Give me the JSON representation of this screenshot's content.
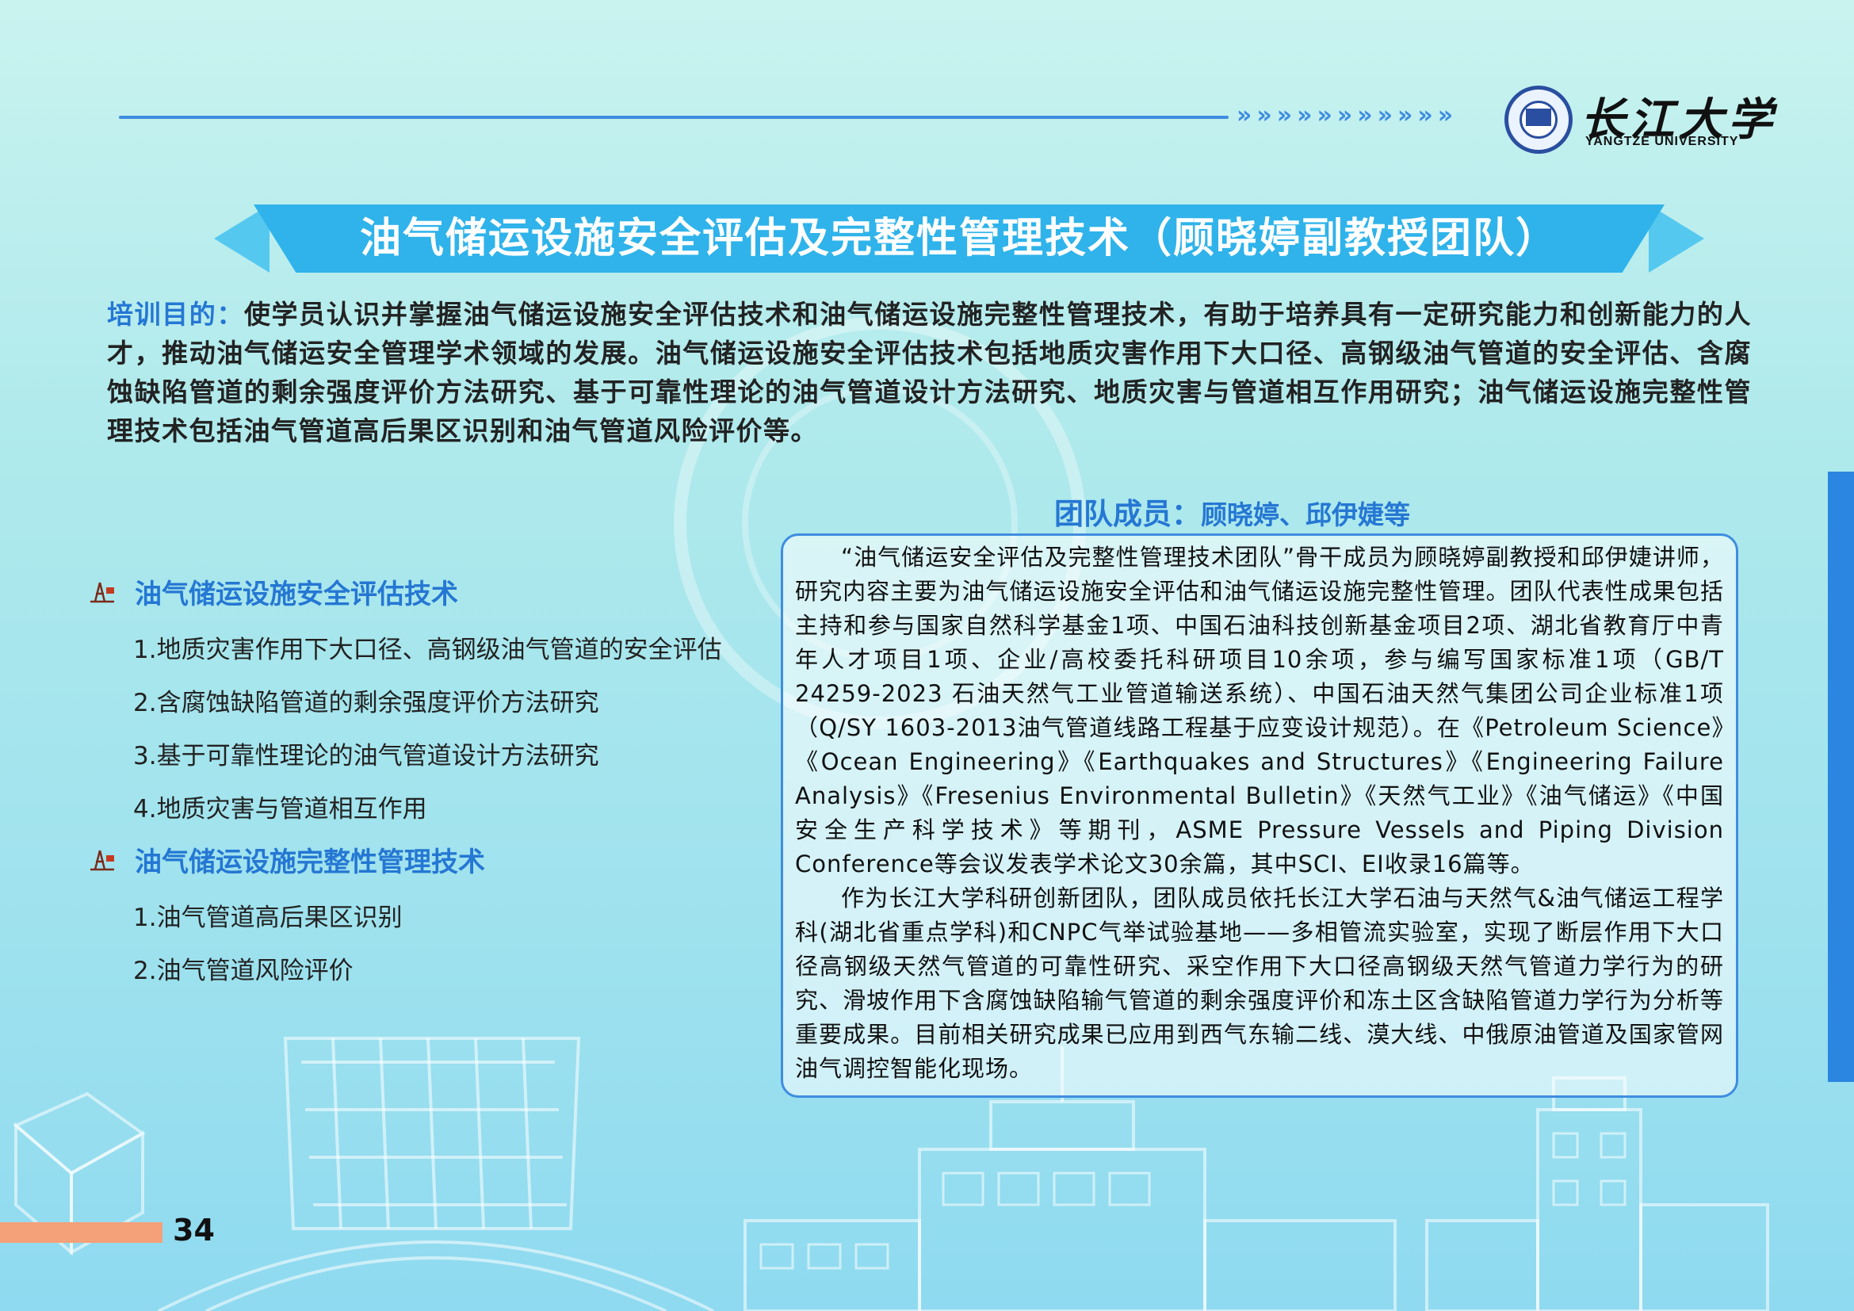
{
  "header": {
    "logo_cn": "长江大学",
    "logo_en": "YANGTZE UNIVERSITY",
    "chevrons": "»»»»»»»»»»»"
  },
  "title": "油气储运设施安全评估及完整性管理技术（顾晓婷副教授团队）",
  "purpose": {
    "label": "培训目的：",
    "text": "使学员认识并掌握油气储运设施安全评估技术和油气储运设施完整性管理技术，有助于培养具有一定研究能力和创新能力的人才，推动油气储运安全管理学术领域的发展。油气储运设施安全评估技术包括地质灾害作用下大口径、高钢级油气管道的安全评估、含腐蚀缺陷管道的剩余强度评价方法研究、基于可靠性理论的油气管道设计方法研究、地质灾害与管道相互作用研究；油气储运设施完整性管理技术包括油气管道高后果区识别和油气管道风险评价等。"
  },
  "sections": [
    {
      "heading": "油气储运设施安全评估技术",
      "items": [
        "1.地质灾害作用下大口径、高钢级油气管道的安全评估",
        "2.含腐蚀缺陷管道的剩余强度评价方法研究",
        "3.基于可靠性理论的油气管道设计方法研究",
        "4.地质灾害与管道相互作用"
      ]
    },
    {
      "heading": "油气储运设施完整性管理技术",
      "items": [
        "1.油气管道高后果区识别",
        "2.油气管道风险评价"
      ]
    }
  ],
  "team": {
    "label": "团队成员：",
    "members": "顾晓婷、邱伊婕等",
    "paragraphs": [
      "“油气储运安全评估及完整性管理技术团队”骨干成员为顾晓婷副教授和邱伊婕讲师，研究内容主要为油气储运设施安全评估和油气储运设施完整性管理。团队代表性成果包括主持和参与国家自然科学基金1项、中国石油科技创新基金项目2项、湖北省教育厅中青年人才项目1项、企业/高校委托科研项目10余项，参与编写国家标准1项（GB/T 24259-2023 石油天然气工业管道输送系统）、中国石油天然气集团公司企业标准1项（Q/SY 1603-2013油气管道线路工程基于应变设计规范）。在《Petroleum Science》《Ocean Engineering》《Earthquakes and Structures》《Engineering Failure Analysis》《Fresenius Environmental Bulletin》《天然气工业》《油气储运》《中国安全生产科学技术》等期刊，ASME Pressure Vessels and Piping Division Conference等会议发表学术论文30余篇，其中SCI、EI收录16篇等。",
      "作为长江大学科研创新团队，团队成员依托长江大学石油与天然气&油气储运工程学科(湖北省重点学科)和CNPC气举试验基地——多相管流实验室，实现了断层作用下大口径高钢级天然气管道的可靠性研究、采空作用下大口径高钢级天然气管道力学行为的研究、滑坡作用下含腐蚀缺陷输气管道的剩余强度评价和冻土区含缺陷管道力学行为分析等重要成果。目前相关研究成果已应用到西气东输二线、漠大线、中俄原油管道及国家管网油气调控智能化现场。"
    ]
  },
  "page_number": "34",
  "icons": {
    "section_icon": "oil-rig-icon",
    "logo": "university-seal-icon"
  },
  "colors": {
    "accent_blue": "#2577d3",
    "banner": "#2fb3ea",
    "page_bar": "#f4a079"
  }
}
